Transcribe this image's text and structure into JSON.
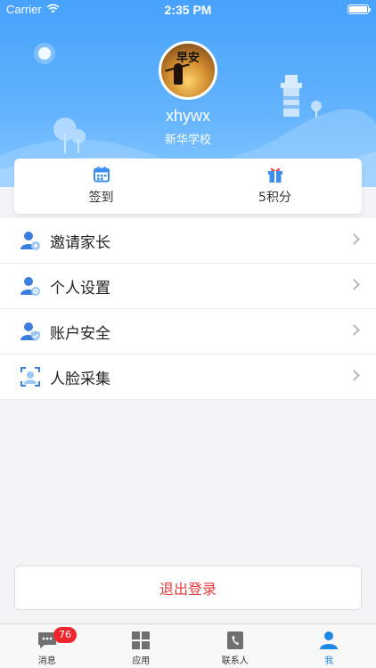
{
  "status_bar": {
    "carrier": "Carrier",
    "time": "2:35 PM"
  },
  "profile": {
    "avatar_text": "早安",
    "username": "xhywx",
    "school": "新华学校"
  },
  "quick_card": {
    "checkin_label": "签到",
    "points_label": "5积分",
    "accent": "#3b8ff0",
    "gift_color": "#3b8ff0"
  },
  "menu": {
    "items": [
      {
        "label": "邀请家长",
        "icon": "invite-parent-icon"
      },
      {
        "label": "个人设置",
        "icon": "person-settings-icon"
      },
      {
        "label": "账户安全",
        "icon": "account-security-icon"
      },
      {
        "label": "人脸采集",
        "icon": "face-capture-icon"
      }
    ]
  },
  "logout": {
    "label": "退出登录",
    "color": "#e4393c"
  },
  "tabbar": {
    "tabs": [
      {
        "label": "消息",
        "icon": "message-icon",
        "badge": "76"
      },
      {
        "label": "应用",
        "icon": "apps-grid-icon"
      },
      {
        "label": "联系人",
        "icon": "contacts-icon"
      },
      {
        "label": "我",
        "icon": "me-icon",
        "active": true
      }
    ]
  }
}
